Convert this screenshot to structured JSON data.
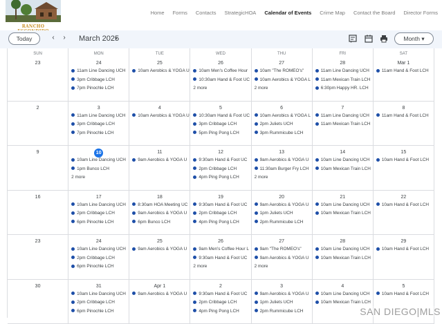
{
  "site": {
    "logo_text": "RANCHO ESCONDIDO"
  },
  "nav": [
    "Home",
    "Forms",
    "Contacts",
    "StrategicHOA",
    "Calendar of Events",
    "Crime Map",
    "Contact the Board",
    "Director Forms"
  ],
  "nav_active": "Calendar of Events",
  "toolbar": {
    "today_label": "Today",
    "prev_icon": "chevron-left-icon",
    "prev_glyph": "‹",
    "next_icon": "chevron-right-icon",
    "next_glyph": "›",
    "month_title": "March 2025",
    "caret": "▾",
    "view_label": "Month ▾",
    "icons": [
      "agenda-icon",
      "calendar-icon",
      "print-icon"
    ]
  },
  "day_headers": [
    "SUN",
    "MON",
    "TUE",
    "WED",
    "THU",
    "FRI",
    "SAT"
  ],
  "today_date": "10",
  "accent_color": "#1a73e8",
  "event_dot_color": "#1e4fa8",
  "weeks": [
    [
      {
        "date": "23",
        "events": []
      },
      {
        "date": "24",
        "events": [
          "11am Line Dancing UCH",
          "3pm Cribbage LCH",
          "7pm Pinochle LCH"
        ]
      },
      {
        "date": "25",
        "events": [
          "10am Aerobics & YOGA U"
        ]
      },
      {
        "date": "26",
        "events": [
          "10am Men's Coffee Hour",
          "10:30am Hand & Foot UC"
        ],
        "more": "2 more"
      },
      {
        "date": "27",
        "events": [
          "10am \"The ROMEO's\"",
          "10am Aerobics & YOGA L"
        ],
        "more": "2 more"
      },
      {
        "date": "28",
        "events": [
          "11am Line Dancing UCH",
          "11am Mexican Train LCH",
          "6:30pm Happy HR. LCH"
        ]
      },
      {
        "date": "Mar 1",
        "events": [
          "11am Hand & Foot LCH"
        ]
      }
    ],
    [
      {
        "date": "2",
        "events": []
      },
      {
        "date": "3",
        "events": [
          "11am Line Dancing UCH",
          "3pm Cribbage LCH",
          "7pm Pinochle LCH"
        ]
      },
      {
        "date": "4",
        "events": [
          "10am Aerobics & YOGA U"
        ]
      },
      {
        "date": "5",
        "events": [
          "10:30am Hand & Foot UC",
          "3pm Cribbage LCH",
          "5pm Ping Pong LCH"
        ]
      },
      {
        "date": "6",
        "events": [
          "10am Aerobics & YOGA L",
          "2pm Juliets UCH",
          "3pm Rummicube LCH"
        ]
      },
      {
        "date": "7",
        "events": [
          "11am Line Dancing UCH",
          "11am Mexican Train LCH"
        ]
      },
      {
        "date": "8",
        "events": [
          "11am Hand & Foot LCH"
        ]
      }
    ],
    [
      {
        "date": "9",
        "events": []
      },
      {
        "date": "10",
        "events": [
          "10am Line Dancing UCH",
          "1pm Bunco LCH"
        ],
        "more": "2 more"
      },
      {
        "date": "11",
        "events": [
          "9am Aerobics & YOGA U"
        ]
      },
      {
        "date": "12",
        "events": [
          "9:30am Hand & Foot UC",
          "2pm Cribbage LCH",
          "4pm Ping Pong LCH"
        ]
      },
      {
        "date": "13",
        "events": [
          "9am Aerobics & YOGA U",
          "11:30am Burger Fry LCH"
        ],
        "more": "2 more"
      },
      {
        "date": "14",
        "events": [
          "10am Line Dancing UCH",
          "10am Mexican Train LCH"
        ]
      },
      {
        "date": "15",
        "events": [
          "10am Hand & Foot LCH"
        ]
      }
    ],
    [
      {
        "date": "16",
        "events": []
      },
      {
        "date": "17",
        "events": [
          "10am Line Dancing UCH",
          "2pm Cribbage LCH",
          "6pm Pinochle LCH"
        ]
      },
      {
        "date": "18",
        "events": [
          "8:30am HOA Meeting UC",
          "9am Aerobics & YOGA U",
          "6pm Bunco LCH"
        ]
      },
      {
        "date": "19",
        "events": [
          "9:30am Hand & Foot UC",
          "2pm Cribbage LCH",
          "4pm Ping Pong LCH"
        ]
      },
      {
        "date": "20",
        "events": [
          "9am Aerobics & YOGA U",
          "1pm Juliets UCH",
          "2pm Rummicube LCH"
        ]
      },
      {
        "date": "21",
        "events": [
          "10am Line Dancing UCH",
          "10am Mexican Train LCH"
        ]
      },
      {
        "date": "22",
        "events": [
          "10am Hand & Foot LCH"
        ]
      }
    ],
    [
      {
        "date": "23",
        "events": []
      },
      {
        "date": "24",
        "events": [
          "10am Line Dancing UCH",
          "2pm Cribbage LCH",
          "6pm Pinochle LCH"
        ]
      },
      {
        "date": "25",
        "events": [
          "9am Aerobics & YOGA U"
        ]
      },
      {
        "date": "26",
        "events": [
          "9am Men's Coffee Hour L",
          "9:30am Hand & Foot UC"
        ],
        "more": "2 more"
      },
      {
        "date": "27",
        "events": [
          "9am \"The ROMEO's\"",
          "9am Aerobics & YOGA U"
        ],
        "more": "2 more"
      },
      {
        "date": "28",
        "events": [
          "10am Line Dancing UCH",
          "10am Mexican Train LCH"
        ]
      },
      {
        "date": "29",
        "events": [
          "10am Hand & Foot LCH"
        ]
      }
    ],
    [
      {
        "date": "30",
        "events": []
      },
      {
        "date": "31",
        "events": [
          "10am Line Dancing UCH",
          "2pm Cribbage LCH",
          "6pm Pinochle LCH"
        ]
      },
      {
        "date": "Apr 1",
        "events": [
          "9am Aerobics & YOGA U"
        ]
      },
      {
        "date": "2",
        "events": [
          "9:30am Hand & Foot UC",
          "2pm Cribbage LCH",
          "4pm Ping Pong LCH"
        ]
      },
      {
        "date": "3",
        "events": [
          "9am Aerobics & YOGA U",
          "1pm Juliets UCH",
          "2pm Rummicube LCH"
        ]
      },
      {
        "date": "4",
        "events": [
          "10am Line Dancing UCH",
          "10am Mexican Train LCH"
        ]
      },
      {
        "date": "5",
        "events": [
          "10am Hand & Foot LCH"
        ]
      }
    ]
  ],
  "watermark": "SAN DIEGO|MLS"
}
